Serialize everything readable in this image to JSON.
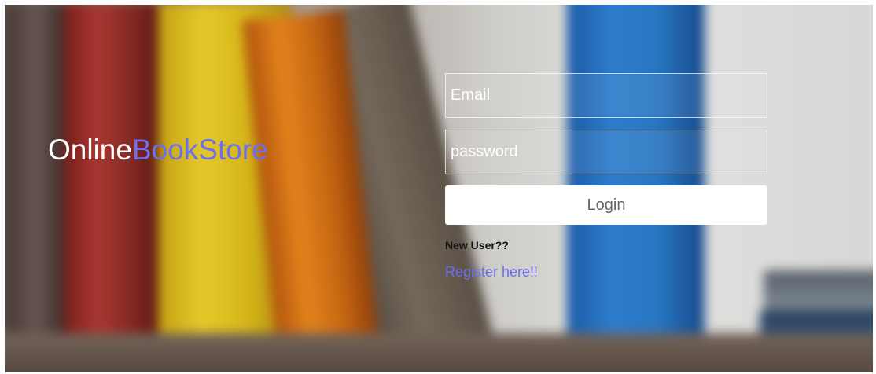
{
  "brand": {
    "part1": "Online",
    "part2": "BookStore",
    "accent_color": "#6b6ff0"
  },
  "login_form": {
    "email_placeholder": "Email",
    "email_value": "",
    "password_placeholder": "password",
    "password_value": "",
    "login_label": "Login",
    "new_user_text": "New User??",
    "register_link_text": "Register here!!"
  }
}
